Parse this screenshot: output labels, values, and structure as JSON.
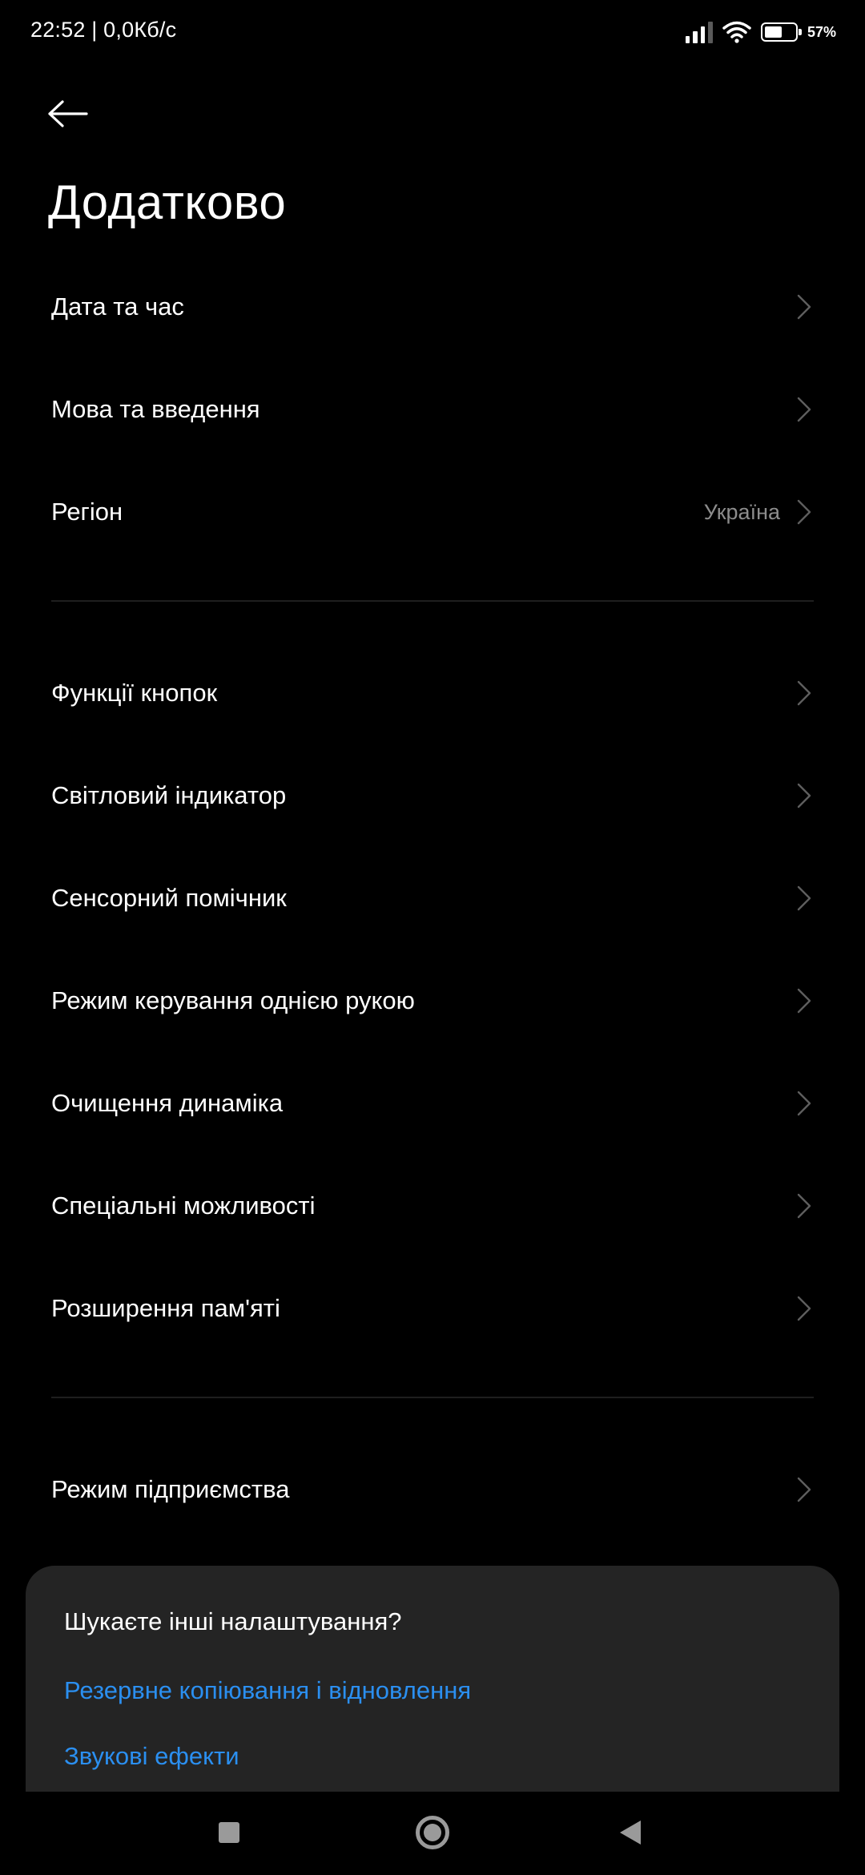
{
  "status_bar": {
    "time_and_speed": "22:52 | 0,0Кб/с",
    "battery_percent_text": "57%",
    "battery_level": 0.57,
    "icons": [
      "signal-icon",
      "wifi-icon",
      "battery-icon"
    ]
  },
  "header": {
    "back_icon": "arrow-left-icon",
    "title": "Додатково"
  },
  "section1": [
    {
      "label": "Дата та час",
      "value": ""
    },
    {
      "label": "Мова та введення",
      "value": ""
    },
    {
      "label": "Регіон",
      "value": "Україна"
    }
  ],
  "section2": [
    {
      "label": "Функції кнопок"
    },
    {
      "label": "Світловий індикатор"
    },
    {
      "label": "Сенсорний помічник"
    },
    {
      "label": "Режим керування однією рукою"
    },
    {
      "label": "Очищення динаміка"
    },
    {
      "label": "Спеціальні можливості"
    },
    {
      "label": "Розширення пам'яті"
    }
  ],
  "section3": [
    {
      "label": "Режим підприємства"
    }
  ],
  "suggestions": {
    "title": "Шукаєте інші налаштування?",
    "links": [
      "Резервне копіювання і відновлення",
      "Звукові ефекти"
    ]
  },
  "colors": {
    "background": "#000000",
    "link": "#2b8ff0",
    "secondary_text": "#8c8c8c",
    "card": "#242424"
  },
  "nav_bar": {
    "icons": [
      "recents-square-icon",
      "home-circle-icon",
      "back-triangle-icon"
    ]
  }
}
